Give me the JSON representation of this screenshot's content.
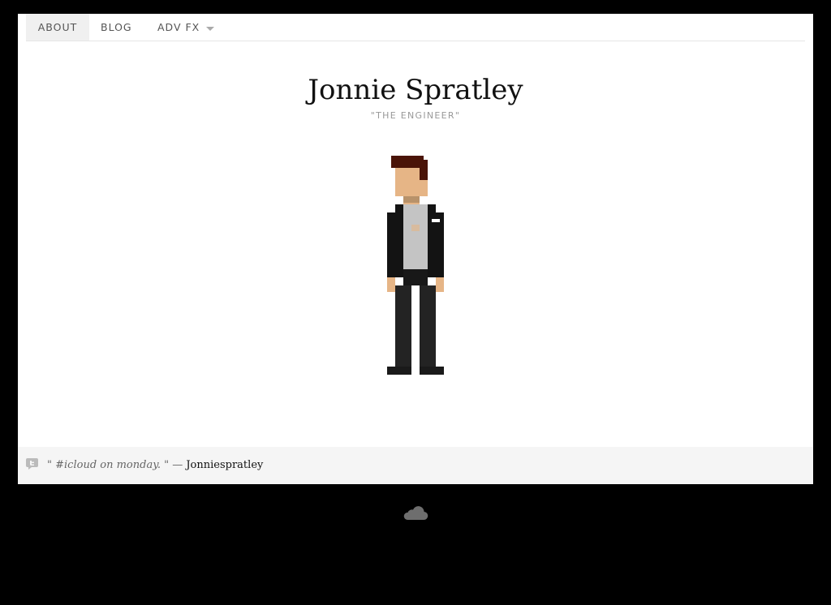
{
  "nav": {
    "items": [
      {
        "label": "ABOUT",
        "active": true
      },
      {
        "label": "BLOG"
      },
      {
        "label": "ADV FX",
        "has_dropdown": true
      }
    ]
  },
  "header": {
    "title": "Jonnie Spratley",
    "subtitle": "\"THE ENGINEER\""
  },
  "avatar": {
    "icon": "pixel-character-illustration"
  },
  "footer": {
    "tweet_icon": "twitter-bird-icon",
    "quote_open": "\" ",
    "quote_body": "#icloud on monday.",
    "quote_close": " \"",
    "separator": " — ",
    "author": "Jonniespratley"
  },
  "bottom_icon": "cloud-icon",
  "colors": {
    "background": "#000000",
    "card": "#ffffff",
    "footer_bg": "#f5f5f5",
    "hair": "#4a1408",
    "skin": "#e6b586",
    "jacket": "#131313",
    "shirt": "#c4c4c4",
    "pants": "#232323"
  }
}
